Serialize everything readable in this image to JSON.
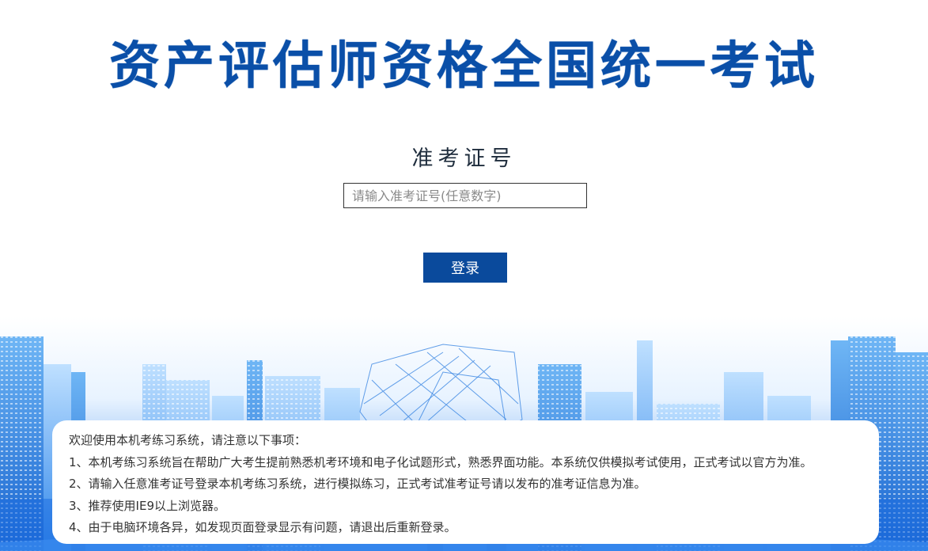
{
  "header": {
    "title": "资产评估师资格全国统一考试"
  },
  "login": {
    "label": "准考证号",
    "placeholder": "请输入准考证号(任意数字)",
    "value": "",
    "button_label": "登录"
  },
  "notice": {
    "intro": "欢迎使用本机考练习系统，请注意以下事项：",
    "items": [
      "1、本机考练习系统旨在帮助广大考生提前熟悉机考环境和电子化试题形式，熟悉界面功能。本系统仅供模拟考试使用，正式考试以官方为准。",
      "2、请输入任意准考证号登录本机考练习系统，进行模拟练习，正式考试准考证号请以发布的准考证信息为准。",
      "3、推荐使用IE9以上浏览器。",
      "4、由于电脑环境各异，如发现页面登录显示有问题，请退出后重新登录。"
    ]
  },
  "colors": {
    "title": "#0a4fa8",
    "button": "#0a4a9c",
    "skyline_light": "#cfe7ff",
    "skyline_mid": "#5aaaf0",
    "skyline_dark": "#1f6fd8"
  }
}
